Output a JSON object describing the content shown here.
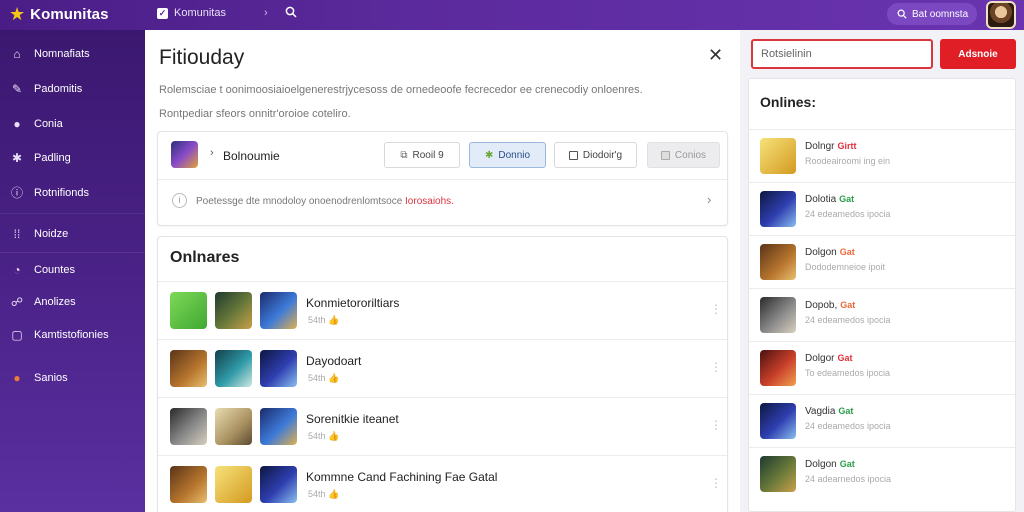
{
  "app": {
    "name": "Komunitas"
  },
  "topbar": {
    "group_label": "Komunitas",
    "pill_label": "Bat oomnsta"
  },
  "sidebar": {
    "items": [
      {
        "label": "Nomnafiats",
        "icon": "home-icon"
      },
      {
        "label": "Padomitis",
        "icon": "compass-icon"
      },
      {
        "label": "Conia",
        "icon": "circle-icon"
      },
      {
        "label": "Padling",
        "icon": "puzzle-icon"
      },
      {
        "label": "Rotnifionds",
        "icon": "info-icon"
      },
      {
        "label": "Noidze",
        "icon": "grid-icon"
      },
      {
        "label": "Countes",
        "icon": "chat-icon"
      },
      {
        "label": "Anolizes",
        "icon": "people-icon"
      },
      {
        "label": "Kamtistofionies",
        "icon": "calendar-icon"
      },
      {
        "label": "Sanios",
        "icon": "fire-icon"
      }
    ]
  },
  "panel": {
    "title": "Fitiouday",
    "description_line1": "Rolemsciae t oonimoosiaioelgenerestrjycesoss de ornedeoofe fecrecedor ee crenecodiy onloenres.",
    "description_line2": "Rontpediar sfeors onnitr'oroioe coteliro.",
    "game_card": {
      "name": "Bolnoumie",
      "chips": [
        {
          "label": "Rooil 9",
          "icon": "copy-icon",
          "state": "normal"
        },
        {
          "label": "Donnio",
          "icon": "puzzle-icon",
          "state": "active"
        },
        {
          "label": "Diodoir'g",
          "icon": "checkbox",
          "state": "normal"
        },
        {
          "label": "Conios",
          "icon": "checkbox",
          "state": "disabled"
        }
      ],
      "notice_text": "Poetessge dte mnodoloy onoenodrenlomtsoce",
      "notice_link": "Iorosaiohs."
    },
    "section_title": "Onlnares",
    "rows": [
      {
        "title": "Konmietororiltiars",
        "meta": "54th"
      },
      {
        "title": "Dayodoart",
        "meta": "54th"
      },
      {
        "title": "Sorenitkie iteanet",
        "meta": "54th"
      },
      {
        "title": "Kommne Cand Fachining Fae Gatal",
        "meta": "54th"
      }
    ]
  },
  "right": {
    "search_value": "Rotsielinin",
    "button_label": "Adsnoie",
    "title": "Onlines:",
    "items": [
      {
        "name": "Dolngr",
        "tag": "Girtt",
        "tag_color": "#e0303a",
        "sub": "Roodeairoomi ing ein"
      },
      {
        "name": "Dolotia",
        "tag": "Gat",
        "tag_color": "#2a9d4a",
        "sub": "24 edeamedos ipocia"
      },
      {
        "name": "Dolgon",
        "tag": "Gat",
        "tag_color": "#e8683a",
        "sub": "Dododemneioe ipoit"
      },
      {
        "name": "Dopob,",
        "tag": "Gat",
        "tag_color": "#e8683a",
        "sub": "24 edeamedos ipocia"
      },
      {
        "name": "Dolgor",
        "tag": "Gat",
        "tag_color": "#e0303a",
        "sub": "To edeamedos ipocia"
      },
      {
        "name": "Vagdia",
        "tag": "Gat",
        "tag_color": "#2a9d4a",
        "sub": "24 edeamedos ipocia"
      },
      {
        "name": "Dolgon",
        "tag": "Gat",
        "tag_color": "#2a9d4a",
        "sub": "24 adearnedos ipocia"
      }
    ]
  }
}
